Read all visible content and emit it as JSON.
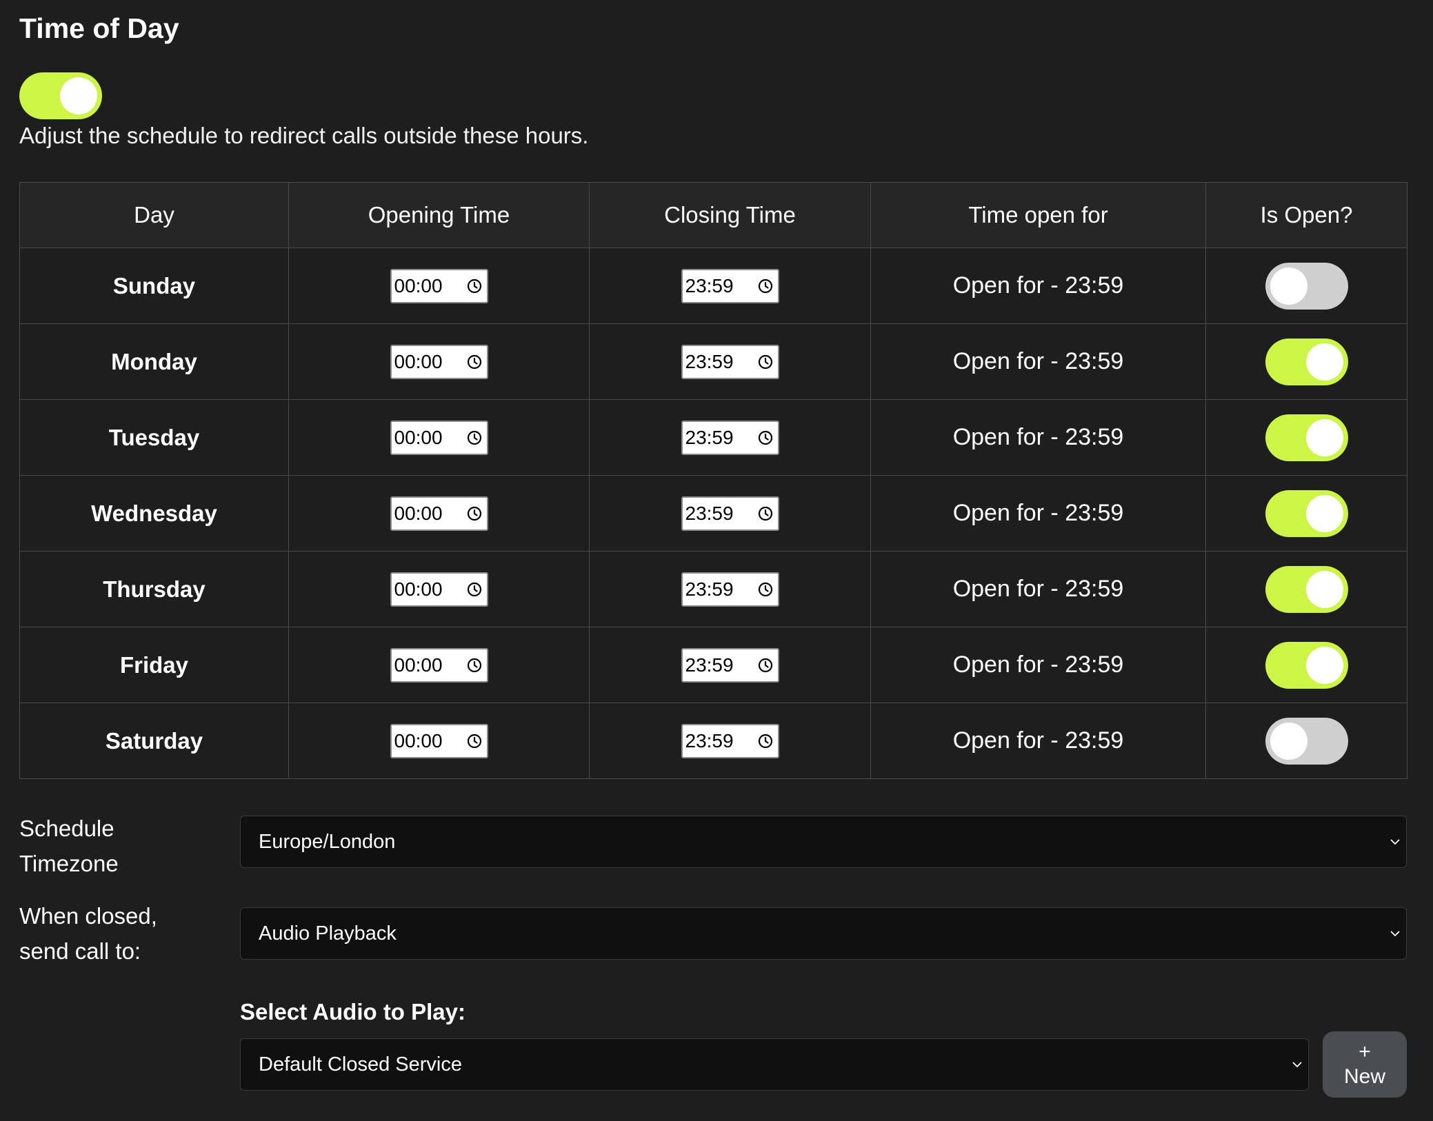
{
  "title": "Time of Day",
  "master_toggle_on": true,
  "description": "Adjust the schedule to redirect calls outside these hours.",
  "table": {
    "headers": [
      "Day",
      "Opening Time",
      "Closing Time",
      "Time open for",
      "Is Open?"
    ],
    "rows": [
      {
        "day": "Sunday",
        "opening": "00:00",
        "closing": "23:59",
        "open_for": "Open for - 23:59",
        "is_open": false
      },
      {
        "day": "Monday",
        "opening": "00:00",
        "closing": "23:59",
        "open_for": "Open for - 23:59",
        "is_open": true
      },
      {
        "day": "Tuesday",
        "opening": "00:00",
        "closing": "23:59",
        "open_for": "Open for - 23:59",
        "is_open": true
      },
      {
        "day": "Wednesday",
        "opening": "00:00",
        "closing": "23:59",
        "open_for": "Open for - 23:59",
        "is_open": true
      },
      {
        "day": "Thursday",
        "opening": "00:00",
        "closing": "23:59",
        "open_for": "Open for - 23:59",
        "is_open": true
      },
      {
        "day": "Friday",
        "opening": "00:00",
        "closing": "23:59",
        "open_for": "Open for - 23:59",
        "is_open": true
      },
      {
        "day": "Saturday",
        "opening": "00:00",
        "closing": "23:59",
        "open_for": "Open for - 23:59",
        "is_open": false
      }
    ]
  },
  "timezone": {
    "label_line1": "Schedule",
    "label_line2": "Timezone",
    "value": "Europe/London"
  },
  "closed_action": {
    "label_line1": "When closed,",
    "label_line2": "send call to:",
    "value": "Audio Playback"
  },
  "audio": {
    "heading": "Select Audio to Play:",
    "value": "Default Closed Service",
    "new_button_plus": "+",
    "new_button_label": "New"
  },
  "colors": {
    "accent": "#cdf546",
    "toggle_off": "#cfcfcf",
    "background": "#1e1e1e",
    "select_background": "#101010",
    "button_background": "#4a4d52"
  },
  "icons": {
    "time_input": "clock-icon",
    "select": "chevron-down-icon"
  }
}
